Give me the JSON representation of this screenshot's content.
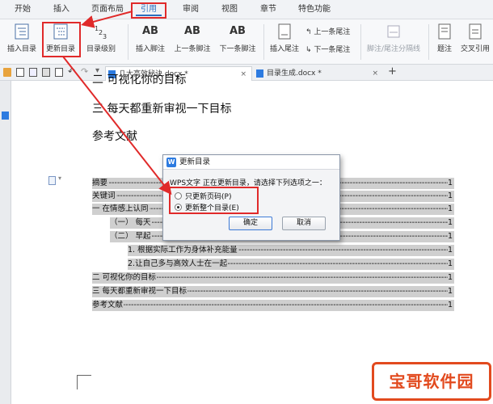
{
  "menu": {
    "tabs": [
      "开始",
      "插入",
      "页面布局",
      "引用",
      "审阅",
      "视图",
      "章节",
      "特色功能"
    ],
    "active": "引用"
  },
  "ribbon": {
    "insert_toc": "插入目录",
    "update_toc": "更新目录",
    "toc_level": "目录级别",
    "insert_footnote": "插入脚注",
    "prev_footnote": "上一条脚注",
    "next_footnote": "下一条脚注",
    "insert_endnote": "插入尾注",
    "prev_endnote": "上一条尾注",
    "next_endnote": "下一条尾注",
    "footnote_separator": "脚注/尾注分隔线",
    "caption": "题注",
    "cross_reference": "交叉引用",
    "ab_label": "AB"
  },
  "doc_tabs": [
    {
      "name": "几大高效秘诀.docx *",
      "active": true
    },
    {
      "name": "目录生成.docx *",
      "active": false
    }
  ],
  "document": {
    "heading_cut": "二 可视化你的目标",
    "heading_3": "三 每天都重新审视一下目标",
    "references": "参考文献",
    "toc": [
      {
        "text": "摘要",
        "page": "1"
      },
      {
        "text": "关键词",
        "page": "1"
      },
      {
        "text": "一 在情感上认同",
        "page": "1"
      },
      {
        "text": "（一） 每天",
        "page": "1"
      },
      {
        "text": "（二） 早起",
        "page": "1"
      },
      {
        "text": "1. 根据实际工作为身体补充能量",
        "page": "1"
      },
      {
        "text": "2.让自己多与高效人士在一起",
        "page": "1"
      },
      {
        "text": "二 可视化你的目标",
        "page": "1"
      },
      {
        "text": "三 每天都重新审视一下目标",
        "page": "1"
      },
      {
        "text": "参考文献",
        "page": "1"
      }
    ]
  },
  "dialog": {
    "title": "更新目录",
    "message": "WPS文字 正在更新目录，请选择下列选项之一：",
    "option_pages": "只更新页码(P)",
    "option_whole": "更新整个目录(E)",
    "selected": "option_whole",
    "ok": "确定",
    "cancel": "取消"
  },
  "watermark": "宝哥软件园",
  "colors": {
    "accent": "#2c6fbf",
    "annotation_red": "#e02a2a",
    "toc_highlight": "#cfcfcf"
  }
}
